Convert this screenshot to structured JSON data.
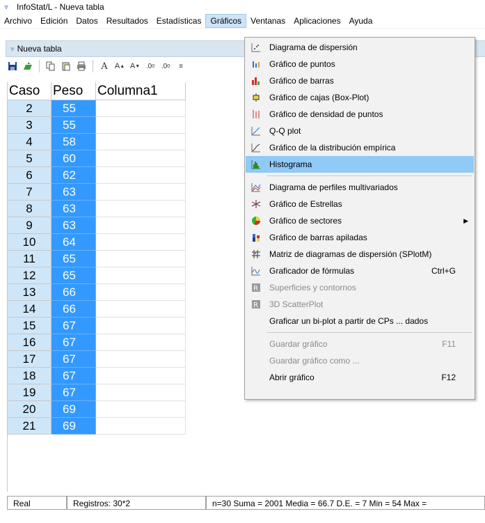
{
  "window": {
    "title": "InfoStat/L - Nueva tabla"
  },
  "menubar": [
    {
      "label": "Archivo"
    },
    {
      "label": "Edición"
    },
    {
      "label": "Datos"
    },
    {
      "label": "Resultados"
    },
    {
      "label": "Estadísticas"
    },
    {
      "label": "Gráficos",
      "active": true
    },
    {
      "label": "Ventanas"
    },
    {
      "label": "Aplicaciones"
    },
    {
      "label": "Ayuda"
    }
  ],
  "child_window": {
    "title": "Nueva tabla"
  },
  "grid": {
    "headers": [
      "Caso",
      "Peso",
      "Columna1"
    ],
    "rows": [
      {
        "caso": "2",
        "peso": "55"
      },
      {
        "caso": "3",
        "peso": "55"
      },
      {
        "caso": "4",
        "peso": "58"
      },
      {
        "caso": "5",
        "peso": "60"
      },
      {
        "caso": "6",
        "peso": "62"
      },
      {
        "caso": "7",
        "peso": "63"
      },
      {
        "caso": "8",
        "peso": "63"
      },
      {
        "caso": "9",
        "peso": "63"
      },
      {
        "caso": "10",
        "peso": "64"
      },
      {
        "caso": "11",
        "peso": "65"
      },
      {
        "caso": "12",
        "peso": "65"
      },
      {
        "caso": "13",
        "peso": "66"
      },
      {
        "caso": "14",
        "peso": "66"
      },
      {
        "caso": "15",
        "peso": "67"
      },
      {
        "caso": "16",
        "peso": "67"
      },
      {
        "caso": "17",
        "peso": "67"
      },
      {
        "caso": "18",
        "peso": "67"
      },
      {
        "caso": "19",
        "peso": "67"
      },
      {
        "caso": "20",
        "peso": "69"
      },
      {
        "caso": "21",
        "peso": "69"
      }
    ]
  },
  "statusbar": {
    "type": "Real",
    "registros": "Registros: 30*2",
    "stats": "n=30  Suma = 2001  Media = 66.7  D.E. = 7  Min = 54  Max ="
  },
  "graficos_menu": {
    "items": [
      {
        "label": "Diagrama de dispersión",
        "icon": "scatter-icon",
        "enabled": true
      },
      {
        "label": "Gráfico de puntos",
        "icon": "dot-plot-icon",
        "enabled": true
      },
      {
        "label": "Gráfico de barras",
        "icon": "bar-chart-icon",
        "enabled": true
      },
      {
        "label": "Gráfico de cajas (Box-Plot)",
        "icon": "box-plot-icon",
        "enabled": true
      },
      {
        "label": "Gráfico de densidad de puntos",
        "icon": "density-icon",
        "enabled": true
      },
      {
        "label": "Q-Q plot",
        "icon": "qq-plot-icon",
        "enabled": true
      },
      {
        "label": "Gráfico de la distribución empírica",
        "icon": "ecdf-icon",
        "enabled": true
      },
      {
        "label": "Histograma",
        "icon": "histogram-icon",
        "enabled": true,
        "highlighted": true,
        "sep_after": true
      },
      {
        "label": "Diagrama de perfiles multivariados",
        "icon": "profiles-icon",
        "enabled": true
      },
      {
        "label": "Gráfico de Estrellas",
        "icon": "stars-icon",
        "enabled": true
      },
      {
        "label": "Gráfico de sectores",
        "icon": "pie-icon",
        "enabled": true,
        "submenu": true
      },
      {
        "label": "Gráfico de barras apiladas",
        "icon": "stacked-bars-icon",
        "enabled": true
      },
      {
        "label": "Matriz de diagramas de dispersión (SPlotM)",
        "icon": "matrix-icon",
        "enabled": true
      },
      {
        "label": "Graficador de fórmulas",
        "icon": "formula-icon",
        "enabled": true,
        "shortcut": "Ctrl+G"
      },
      {
        "label": "Superficies y contornos",
        "icon": "surface-icon",
        "enabled": false
      },
      {
        "label": "3D ScatterPlot",
        "icon": "scatter3d-icon",
        "enabled": false
      },
      {
        "label": "Graficar un bi-plot a partir de CPs ... dados",
        "icon": "",
        "enabled": true,
        "sep_after": true
      },
      {
        "label": "Guardar gráfico",
        "icon": "",
        "enabled": false,
        "shortcut": "F11"
      },
      {
        "label": "Guardar gráfico como ...",
        "icon": "",
        "enabled": false
      },
      {
        "label": "Abrir gráfico",
        "icon": "",
        "enabled": true,
        "shortcut": "F12"
      }
    ]
  },
  "colors": {
    "accent": "#3399ff",
    "caso_bg": "#cfe6f9",
    "menu_highlight": "#91c9f7"
  }
}
